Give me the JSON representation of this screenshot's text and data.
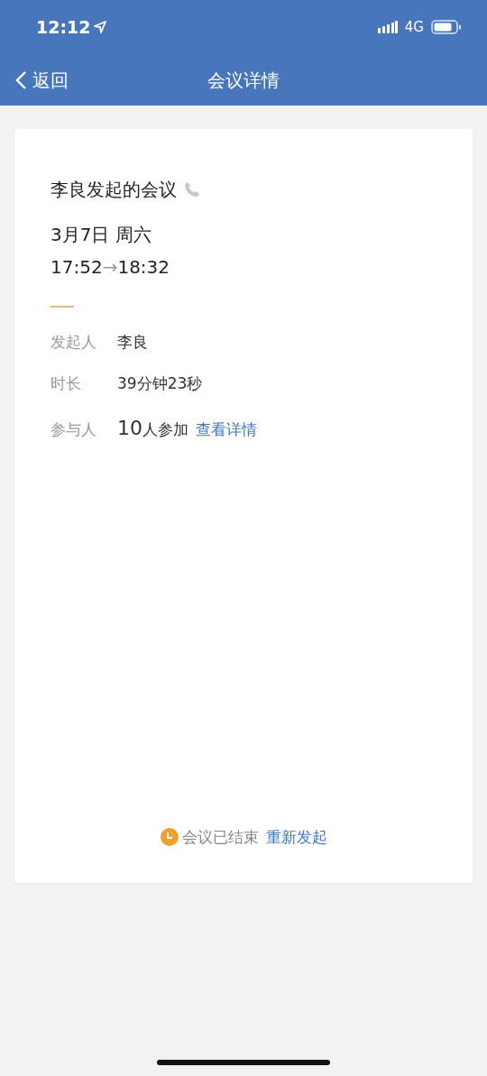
{
  "status_bar": {
    "time": "12:12",
    "network": "4G"
  },
  "nav": {
    "back": "返回",
    "title": "会议详情"
  },
  "meeting": {
    "title": "李良发起的会议",
    "date": "3月7日 周六",
    "start": "17:52",
    "arrow": "→",
    "end": "18:32"
  },
  "details": [
    {
      "kind": "text",
      "label": "发起人",
      "value": "李良"
    },
    {
      "kind": "text",
      "label": "时长",
      "value": "39分钟23秒"
    },
    {
      "kind": "participants",
      "label": "参与人",
      "count": "10",
      "unit": "人参加",
      "link": "查看详情"
    }
  ],
  "footer": {
    "status": "会议已结束",
    "action": "重新发起"
  }
}
